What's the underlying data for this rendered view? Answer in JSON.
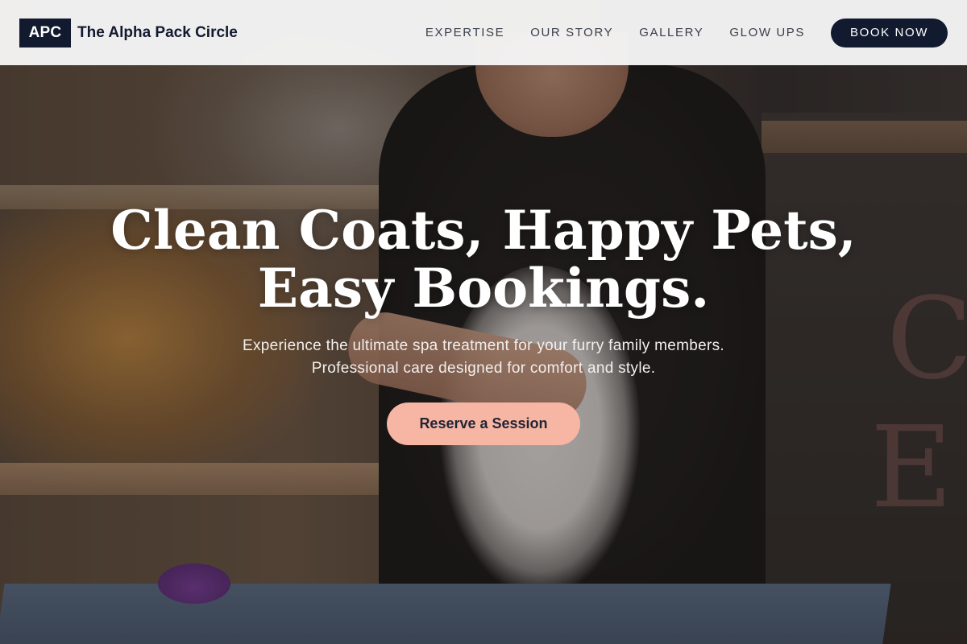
{
  "header": {
    "logo_text": "APC",
    "brand_name": "The Alpha Pack Circle",
    "nav": [
      {
        "label": "EXPERTISE"
      },
      {
        "label": "OUR STORY"
      },
      {
        "label": "GALLERY"
      },
      {
        "label": "GLOW UPS"
      }
    ],
    "book_label": "BOOK NOW"
  },
  "hero": {
    "title_line1": "Clean Coats, Happy Pets,",
    "title_line2": "Easy Bookings.",
    "subtitle_line1": "Experience the ultimate spa treatment for your furry family members.",
    "subtitle_line2": "Professional care designed for comfort and style.",
    "cta_label": "Reserve a Session",
    "background_image": "groomer-brushing-white-dog-photo"
  },
  "colors": {
    "brand_navy": "#111a2e",
    "cta_peach": "#f7b5a3",
    "header_bg": "#f6f6f6"
  }
}
